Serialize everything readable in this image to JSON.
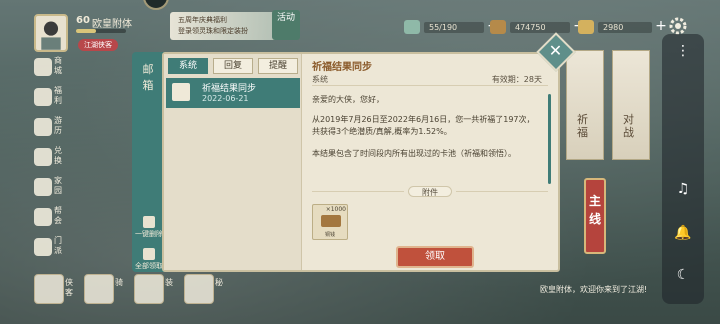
{
  "player": {
    "level": "60",
    "name": "欧皇附体",
    "sect_tag": "江湖侠客"
  },
  "event": {
    "banner_line1": "五周年庆典福利",
    "banner_line2": "登录领灵珠和限定装扮",
    "tag": "活动"
  },
  "currencies": [
    {
      "value": "55/190",
      "icon": "jade-icon"
    },
    {
      "value": "474750",
      "icon": "coin-icon"
    },
    {
      "value": "2980",
      "icon": "ingot-icon"
    }
  ],
  "left_menu": [
    {
      "label": "商城",
      "icon": "shop-icon"
    },
    {
      "label": "福利",
      "icon": "gift-icon"
    },
    {
      "label": "游历",
      "icon": "travel-icon"
    },
    {
      "label": "兑换",
      "icon": "exchange-icon"
    },
    {
      "label": "家园",
      "icon": "home-icon"
    },
    {
      "label": "帮会",
      "icon": "guild-icon"
    },
    {
      "label": "门派",
      "icon": "sect-icon"
    }
  ],
  "bottom_menu": [
    {
      "label": "侠客"
    },
    {
      "label": "骑"
    },
    {
      "label": "装"
    },
    {
      "label": "秘"
    }
  ],
  "mail": {
    "tab_title": "邮箱",
    "filters": [
      "系统",
      "回复",
      "提醒"
    ],
    "delete_all": "一键删除",
    "claim_all": "全部领取",
    "list": [
      {
        "subject": "祈福结果同步",
        "date": "2022-06-21"
      }
    ],
    "detail": {
      "title": "祈福结果同步",
      "sender": "系统",
      "validity": "有效期：28天",
      "greeting": "亲爱的大侠，您好，",
      "paragraph1": "从2019年7月26日至2022年6月16日，您一共祈福了197次，共获得3个绝潜质/真解,概率为1.52%。",
      "paragraph2": "本结果包含了时间段内所有出现过的卡池（祈福和领悟）。",
      "attachments_label": "附件",
      "attachment": {
        "qty": "×1000",
        "name": "铜钱"
      },
      "claim_button": "领取"
    }
  },
  "right_side": {
    "banner1": "祈福",
    "banner2": "对战",
    "main_line": "主线",
    "chat": "欧皇附体，欢迎你来到了江湖!"
  }
}
